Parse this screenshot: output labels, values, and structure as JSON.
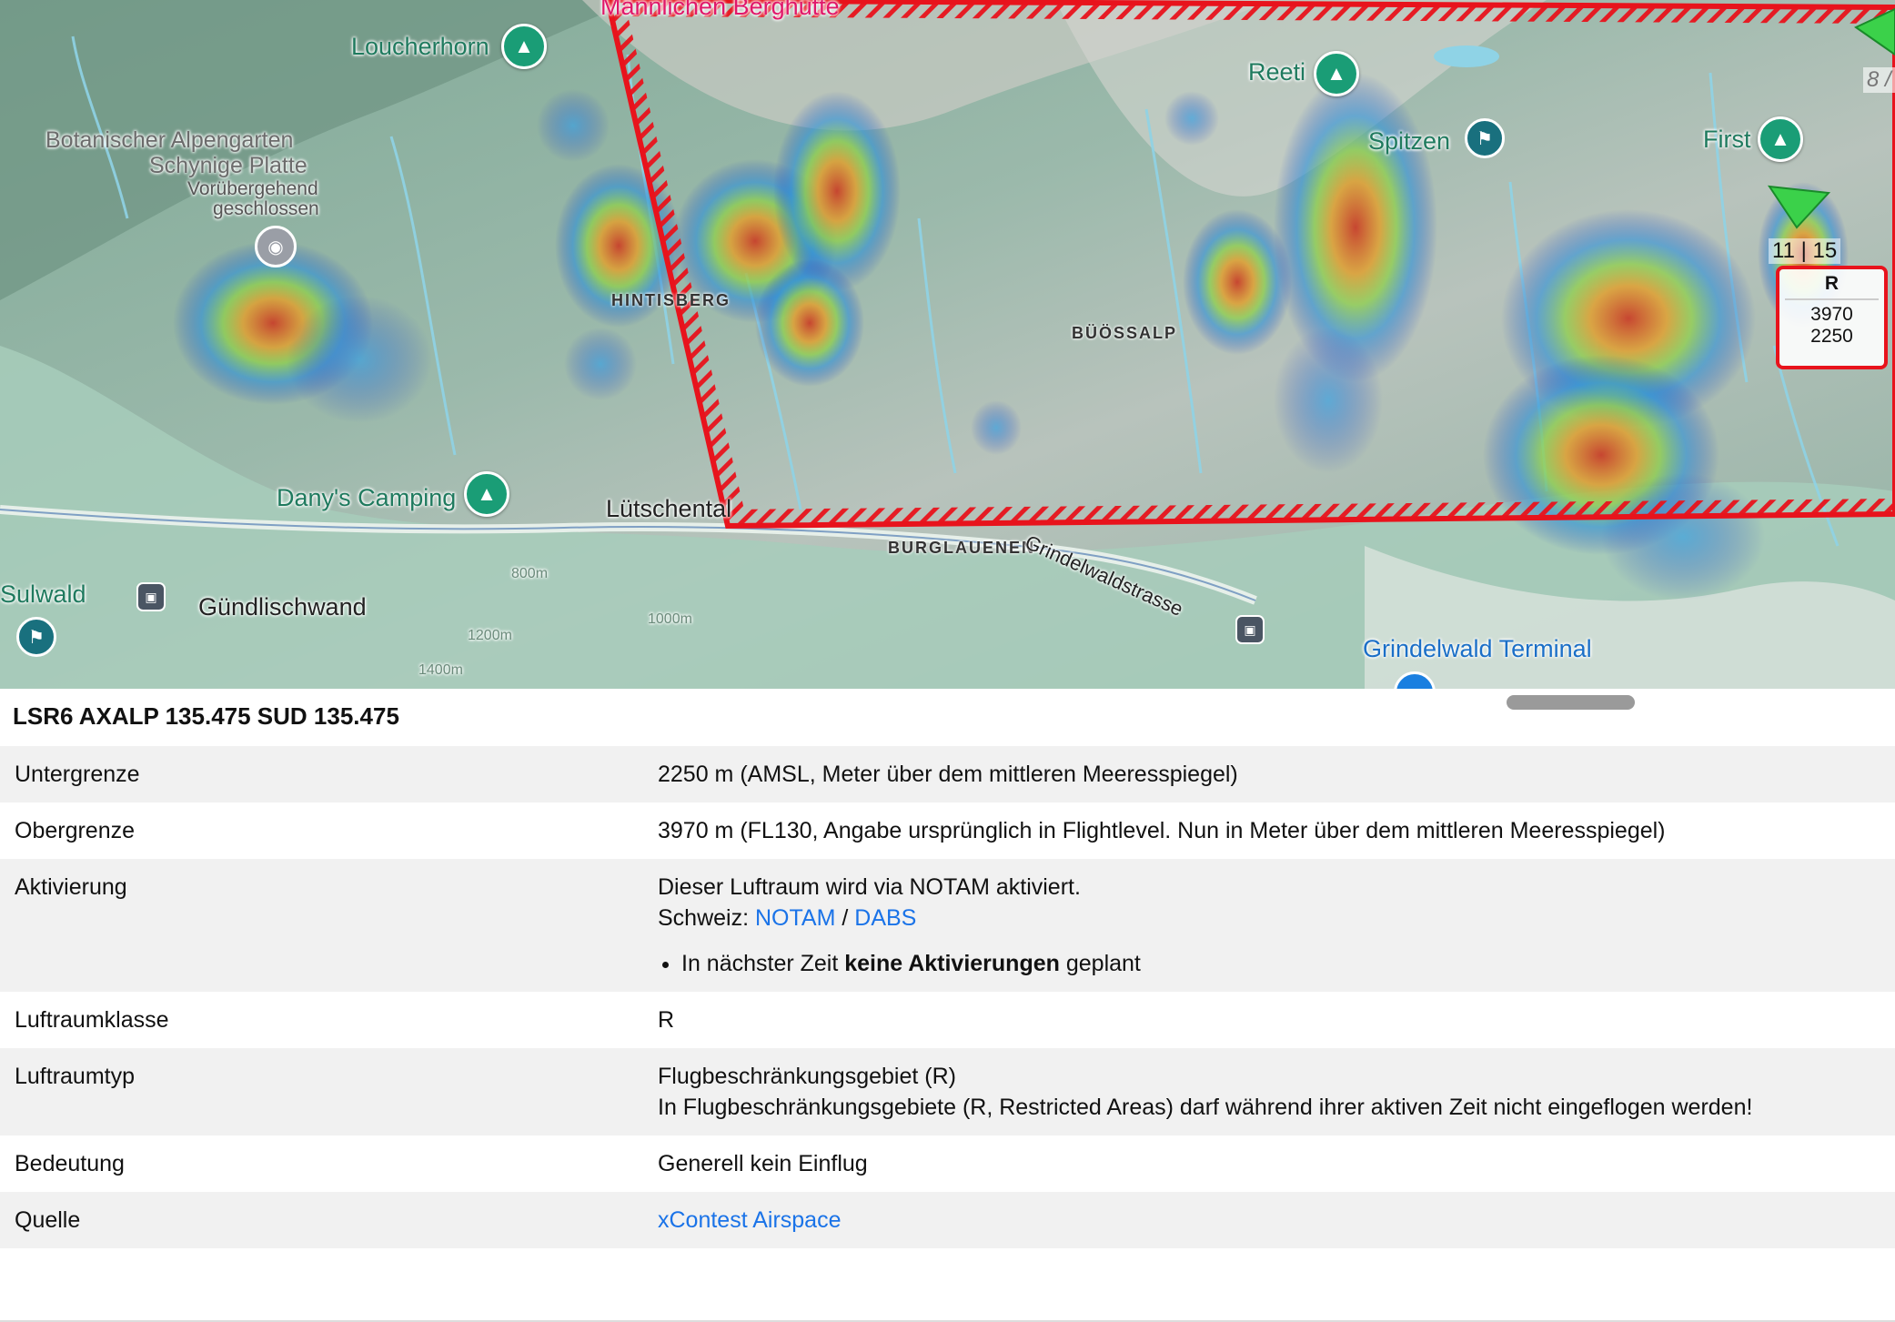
{
  "map": {
    "place_labels": {
      "mannlenen": "Männlichen Berghütte",
      "loucherhorn": "Loucherhorn",
      "botanic_1": "Botanischer Alpengarten",
      "botanic_2": "Schynige Platte",
      "botanic_3": "Vorübergehend",
      "botanic_4": "geschlossen",
      "hintisberg": "HINTISBERG",
      "reeti": "Reeti",
      "spitzen": "Spitzen",
      "first": "First",
      "buossalp": "BÜÖSSALP",
      "danys_camping": "Dany's Camping",
      "lutschental": "Lütschental",
      "burglauenen": "BURGLAUENEN",
      "grindelwaldstrasse": "Grindelwaldstrasse",
      "sulwald": "Sulwald",
      "gundlischwand": "Gündlischwand",
      "grindelwald_terminal": "Grindelwald Terminal"
    },
    "contour_labels": {
      "c800": "800m",
      "c1200": "1200m",
      "c1400": "1400m",
      "c1000": "1000m"
    },
    "icons": {
      "mountain": "mountain-icon",
      "hiker": "hiker-icon",
      "camera": "camera-icon",
      "bus": "bus-icon",
      "pin": "pin-icon",
      "direction": "direction-arrow-icon"
    },
    "colors": {
      "restricted_area": "#e8131c",
      "poi_green": "#1a9d76",
      "link": "#1a73e8"
    },
    "counter": "11 | 15",
    "counter_partial": "8 /",
    "airspace_box": {
      "class": "R",
      "upper": "3970",
      "lower": "2250"
    }
  },
  "panel": {
    "title": "LSR6 AXALP 135.475 SUD 135.475",
    "rows": [
      {
        "key": "Untergrenze",
        "value": "2250 m (AMSL, Meter über dem mittleren Meeresspiegel)"
      },
      {
        "key": "Obergrenze",
        "value": "3970 m (FL130, Angabe ursprünglich in Flightlevel. Nun in Meter über dem mittleren Meeresspiegel)"
      },
      {
        "key": "Aktivierung",
        "line1": "Dieser Luftraum wird via NOTAM aktiviert.",
        "line2_prefix": "Schweiz: ",
        "link_notam": "NOTAM",
        "sep": "/",
        "link_dabs": "DABS",
        "bullet_pre": "In nächster Zeit ",
        "bullet_bold": "keine Aktivierungen",
        "bullet_post": " geplant"
      },
      {
        "key": "Luftraumklasse",
        "value": "R"
      },
      {
        "key": "Luftraumtyp",
        "line1": "Flugbeschränkungsgebiet (R)",
        "line2": "In Flugbeschränkungsgebiete (R, Restricted Areas) darf während ihrer aktiven Zeit nicht eingeflogen werden!"
      },
      {
        "key": "Bedeutung",
        "value": "Generell kein Einflug"
      },
      {
        "key": "Quelle",
        "link": "xContest Airspace"
      }
    ]
  }
}
